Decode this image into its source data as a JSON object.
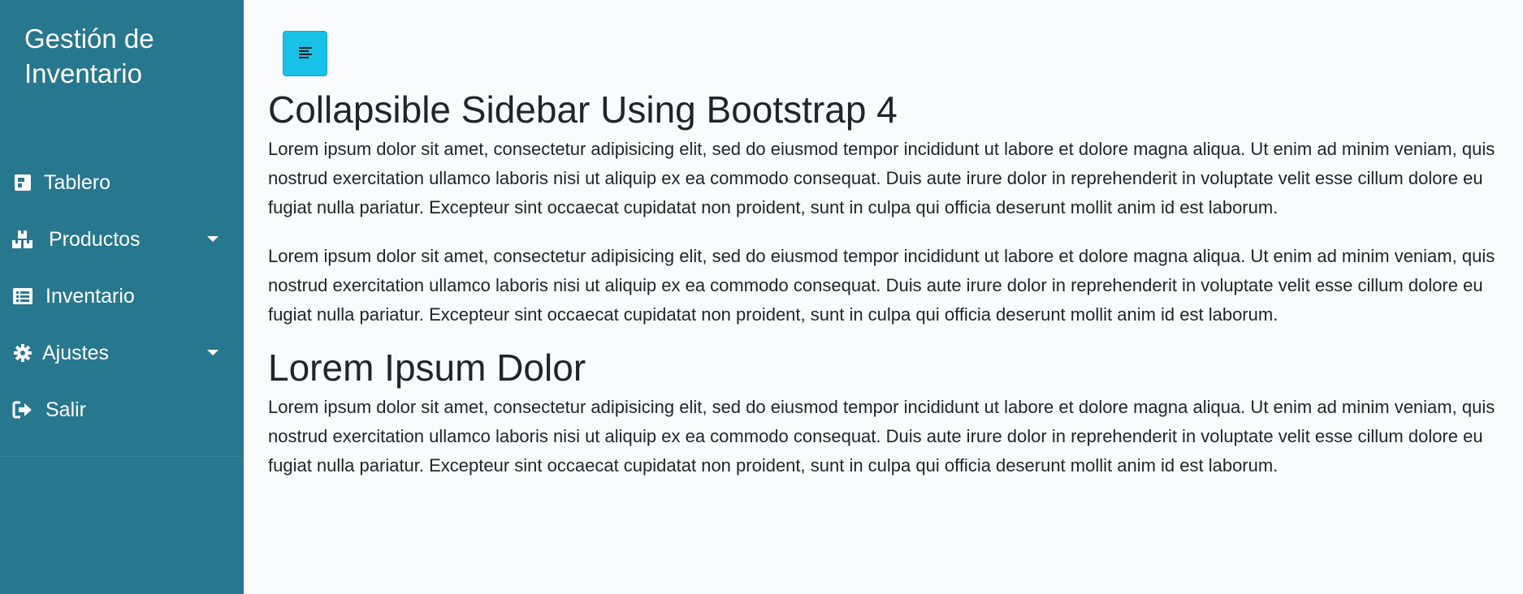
{
  "sidebar": {
    "brand": "Gestión de Inventario",
    "items": [
      {
        "label": "Tablero",
        "icon": "dashboard-icon",
        "has_caret": false
      },
      {
        "label": "Productos",
        "icon": "boxes-icon",
        "has_caret": true
      },
      {
        "label": "Inventario",
        "icon": "list-icon",
        "has_caret": false
      },
      {
        "label": "Ajustes",
        "icon": "gear-icon",
        "has_caret": true
      },
      {
        "label": "Salir",
        "icon": "sign-out-icon",
        "has_caret": false
      }
    ]
  },
  "toggle": {
    "icon": "align-left-icon"
  },
  "main": {
    "title": "Collapsible Sidebar Using Bootstrap 4",
    "paragraph_1": "Lorem ipsum dolor sit amet, consectetur adipisicing elit, sed do eiusmod tempor incididunt ut labore et dolore magna aliqua. Ut enim ad minim veniam, quis nostrud exercitation ullamco laboris nisi ut aliquip ex ea commodo consequat. Duis aute irure dolor in reprehenderit in voluptate velit esse cillum dolore eu fugiat nulla pariatur. Excepteur sint occaecat cupidatat non proident, sunt in culpa qui officia deserunt mollit anim id est laborum.",
    "paragraph_2": "Lorem ipsum dolor sit amet, consectetur adipisicing elit, sed do eiusmod tempor incididunt ut labore et dolore magna aliqua. Ut enim ad minim veniam, quis nostrud exercitation ullamco laboris nisi ut aliquip ex ea commodo consequat. Duis aute irure dolor in reprehenderit in voluptate velit esse cillum dolore eu fugiat nulla pariatur. Excepteur sint occaecat cupidatat non proident, sunt in culpa qui officia deserunt mollit anim id est laborum.",
    "subtitle": "Lorem Ipsum Dolor",
    "paragraph_3": "Lorem ipsum dolor sit amet, consectetur adipisicing elit, sed do eiusmod tempor incididunt ut labore et dolore magna aliqua. Ut enim ad minim veniam, quis nostrud exercitation ullamco laboris nisi ut aliquip ex ea commodo consequat. Duis aute irure dolor in reprehenderit in voluptate velit esse cillum dolore eu fugiat nulla pariatur. Excepteur sint occaecat cupidatat non proident, sunt in culpa qui officia deserunt mollit anim id est laborum."
  },
  "colors": {
    "sidebar_bg": "#27778f",
    "toggle_bg": "#17c1e8",
    "content_bg": "#fafbfc",
    "text": "#212529"
  }
}
